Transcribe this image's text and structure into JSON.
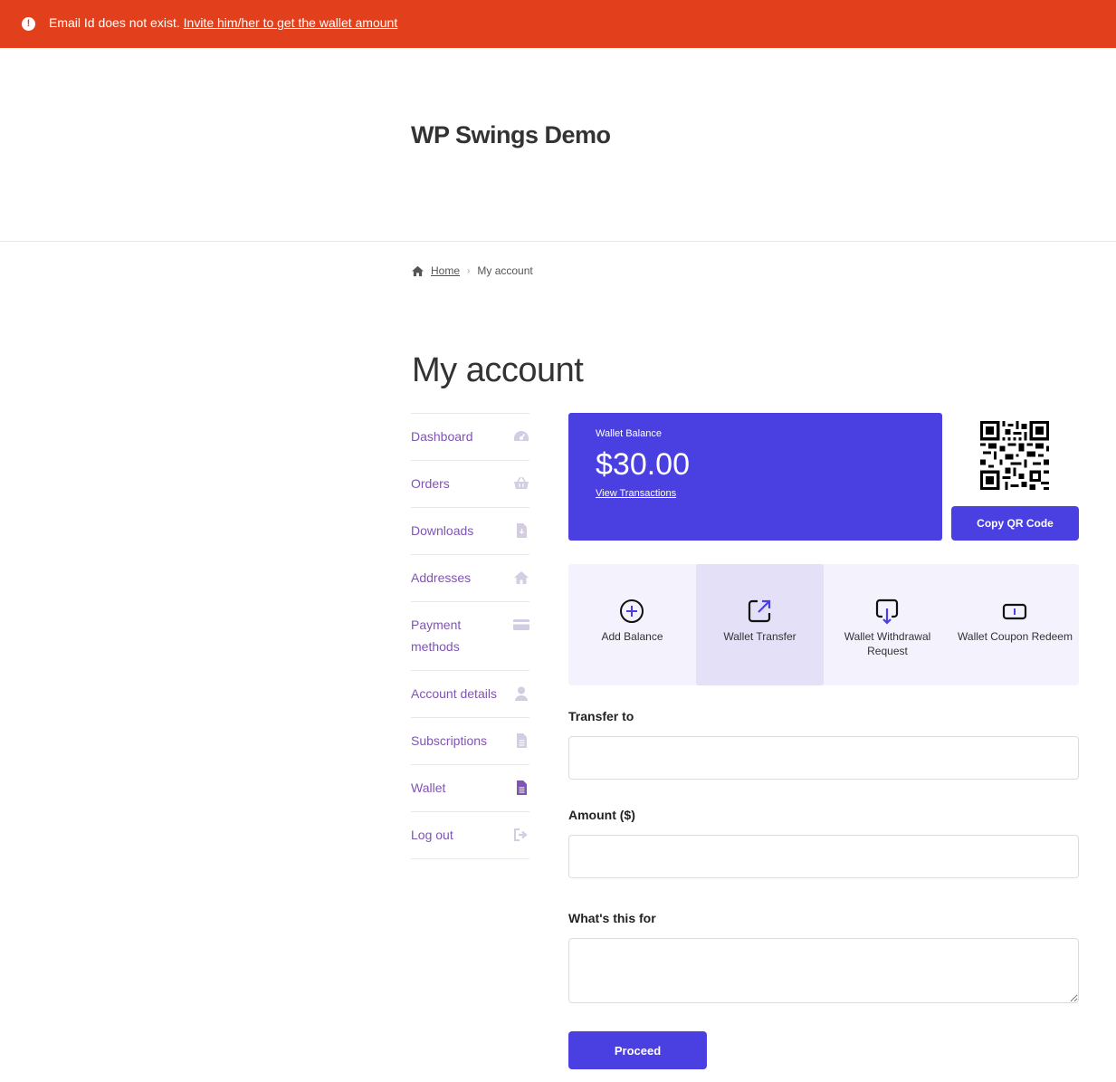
{
  "notice": {
    "message": "Email Id does not exist.",
    "link_text": "Invite him/her to get the wallet amount",
    "color": "#e2401c"
  },
  "site": {
    "title": "WP Swings Demo"
  },
  "breadcrumb": {
    "home": "Home",
    "current": "My account"
  },
  "page": {
    "title": "My account"
  },
  "nav": {
    "items": [
      {
        "label": "Dashboard",
        "icon": "gauge-icon"
      },
      {
        "label": "Orders",
        "icon": "basket-icon"
      },
      {
        "label": "Downloads",
        "icon": "file-download-icon"
      },
      {
        "label": "Addresses",
        "icon": "home-icon"
      },
      {
        "label": "Payment methods",
        "icon": "credit-card-icon"
      },
      {
        "label": "Account details",
        "icon": "user-icon"
      },
      {
        "label": "Subscriptions",
        "icon": "document-icon"
      },
      {
        "label": "Wallet",
        "icon": "wallet-document-icon"
      },
      {
        "label": "Log out",
        "icon": "sign-out-icon"
      }
    ],
    "active": "Wallet",
    "color": "#7f54b3"
  },
  "wallet": {
    "label": "Wallet Balance",
    "amount": "$30.00",
    "view_link": "View Transactions",
    "copy_qr": "Copy QR Code",
    "accent": "#4a3fe0"
  },
  "actions": [
    {
      "label": "Add Balance",
      "icon": "plus-circle-icon",
      "active": false
    },
    {
      "label": "Wallet Transfer",
      "icon": "external-transfer-icon",
      "active": true
    },
    {
      "label": "Wallet Withdrawal Request",
      "icon": "withdraw-icon",
      "active": false
    },
    {
      "label": "Wallet Coupon Redeem",
      "icon": "coupon-icon",
      "active": false
    }
  ],
  "form": {
    "transfer_to": {
      "label": "Transfer to",
      "value": ""
    },
    "amount": {
      "label": "Amount ($)",
      "value": ""
    },
    "purpose": {
      "label": "What's this for",
      "value": ""
    },
    "submit": "Proceed"
  }
}
